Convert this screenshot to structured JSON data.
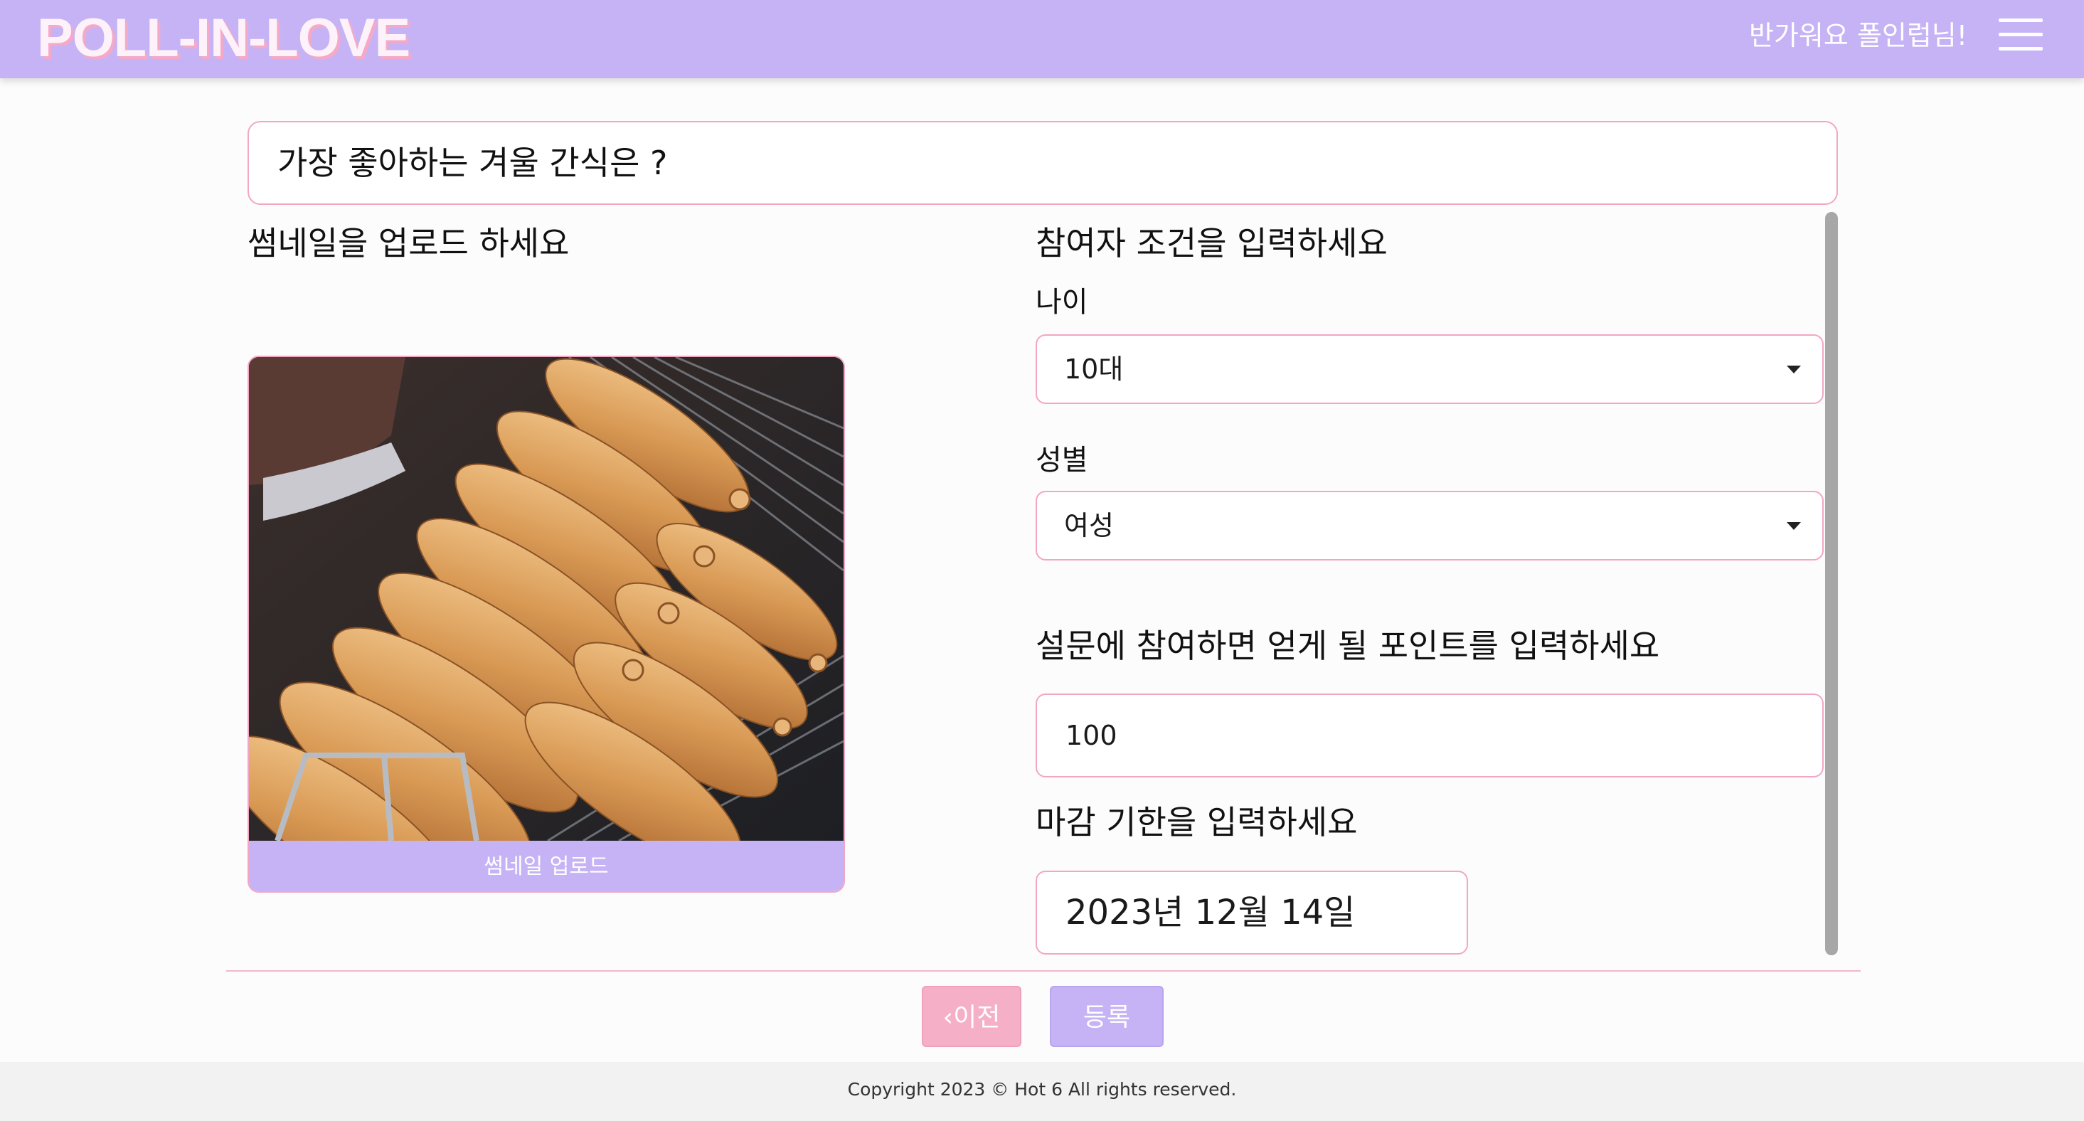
{
  "header": {
    "logo": "POLL-IN-LOVE",
    "greeting": "반가워요 폴인럽님!",
    "menu_icon": "hamburger-menu-icon"
  },
  "poll": {
    "title": "가장 좋아하는 겨울 간식은 ?"
  },
  "thumbnail": {
    "heading": "썸네일을 업로드 하세요",
    "upload_label": "썸네일 업로드"
  },
  "conditions": {
    "heading": "참여자 조건을 입력하세요",
    "age_label": "나이",
    "age_value": "10대",
    "gender_label": "성별",
    "gender_value": "여성"
  },
  "points": {
    "heading": "설문에 참여하면 얻게 될 포인트를 입력하세요",
    "value": "100"
  },
  "deadline": {
    "heading": "마감 기한을 입력하세요",
    "value": "2023년 12월 14일"
  },
  "actions": {
    "prev_label": "이전",
    "submit_label": "등록"
  },
  "footer": {
    "copyright": "Copyright 2023 © Hot 6 All rights reserved."
  },
  "colors": {
    "header_bg": "#c6b3f5",
    "accent_pink": "#f2a6c4",
    "button_prev": "#f5b0c8",
    "button_submit": "#c6b3f5"
  }
}
